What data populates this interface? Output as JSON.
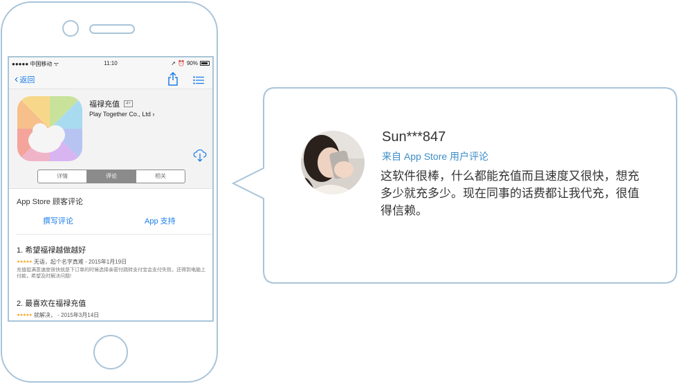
{
  "status_bar": {
    "carrier": "●●●●● 中国移动 ᯤ",
    "time": "11:10",
    "battery": "90%"
  },
  "nav": {
    "back_label": "返回"
  },
  "app": {
    "name": "福禄充值",
    "age_rating": "4+",
    "developer": "Play Together Co., Ltd ›"
  },
  "tabs": [
    {
      "label": "详情",
      "active": false
    },
    {
      "label": "评论",
      "active": true
    },
    {
      "label": "相关",
      "active": false
    }
  ],
  "reviews_section": {
    "title": "App Store 顾客评论",
    "write_label": "撰写评论",
    "support_label": "App 支持"
  },
  "reviews": [
    {
      "title": "1. 希望福禄越做越好",
      "rating": 5,
      "meta": "无语，起个名字真难 - 2015年1月19日",
      "body": "充值挺满意速度很快就是下订单的时候选择亲密付跳转支付宝会支付失败，还得到电脑上付款，希望及时解决问题!"
    },
    {
      "title": "2. 最喜欢在福禄充值",
      "rating": 5,
      "meta": "就解决， - 2015年3月14日",
      "body": ""
    }
  ],
  "testimonial": {
    "user": "Sun***847",
    "source": "来自 App Store 用户评论",
    "text": "这软件很棒，什么都能充值而且速度又很快，想充多少就充多少。现在同事的话费都让我代充，很值得信赖。"
  },
  "colors": {
    "frame": "#a9c4d8",
    "link": "#1a7de8",
    "source": "#3b8dc8",
    "star": "#f5a623"
  }
}
